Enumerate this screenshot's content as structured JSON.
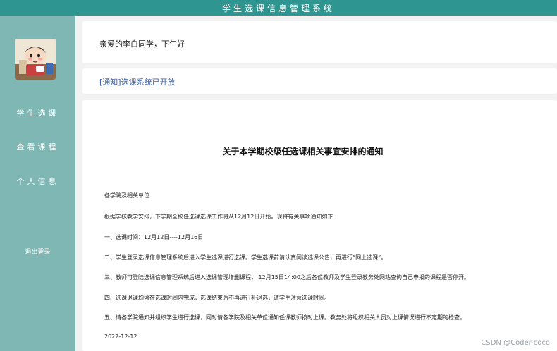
{
  "app": {
    "title": "学生选课信息管理系统"
  },
  "sidebar": {
    "avatar_alt": "cartoon-avatar",
    "items": [
      {
        "label": "学生选课"
      },
      {
        "label": "查看课程"
      },
      {
        "label": "个人信息"
      }
    ],
    "logout_label": "退出登录"
  },
  "greeting": {
    "text": "亲爱的李白同学，下午好"
  },
  "notice": {
    "link_text": "[通知]选课系统已开放"
  },
  "document": {
    "title": "关于本学期校级任选课相关事宜安排的通知",
    "lines": [
      "各学院及相关单位:",
      "根据学校教学安排，下学期全校任选课选课工作将从12月12日开始。现将有关事项通知如下:",
      "一、选课时间：12月12日----12月16日",
      "二、学生登录选课信息管理系统后进入学生选课进行选课。学生选课前请认真阅读选课公告，再进行“网上选课”。",
      "三、教师可登陆选课信息管理系统后进入选课管理增删课程， 12月15日14:00之后各位教师及学生登录教务处网站查询自己申报的课程是否停开。",
      "四、选课退课均须在选课时间内完成，选课结束后不再进行补退选，请学生注意选课时间。",
      "五、请各学院通知并组织学生进行选课，同时请各学院及相关单位通知任课教师按时上课。教务处将组织相关人员对上课情况进行不定期的检查。",
      "2022-12-12"
    ]
  },
  "watermark": {
    "text": "CSDN @Coder-coco"
  },
  "colors": {
    "topbar": "#2f9590",
    "sidebar": "#7fb7b5",
    "link": "#3b62a8",
    "background": "#f2f2f2"
  }
}
